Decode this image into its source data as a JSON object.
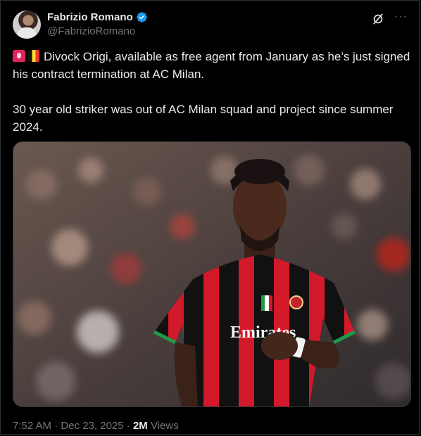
{
  "author": {
    "display_name": "Fabrizio Romano",
    "handle": "@FabrizioRomano"
  },
  "tweet": {
    "line1": "Divock Origi, available as free agent from January as he’s just signed his contract termination at AC Milan.",
    "line2": "30 year old striker was out of AC Milan squad and project since summer 2024."
  },
  "media": {
    "shirt_sponsor": "Emirates"
  },
  "meta": {
    "time": "7:52 AM",
    "separator": "·",
    "date": "Dec 23, 2025",
    "views_count": "2M",
    "views_label": "Views"
  },
  "colors": {
    "background": "#000000",
    "text": "#e7e9ea",
    "secondary": "#71767b",
    "verified": "#1d9bf0",
    "milan_red": "#d21a2a"
  }
}
